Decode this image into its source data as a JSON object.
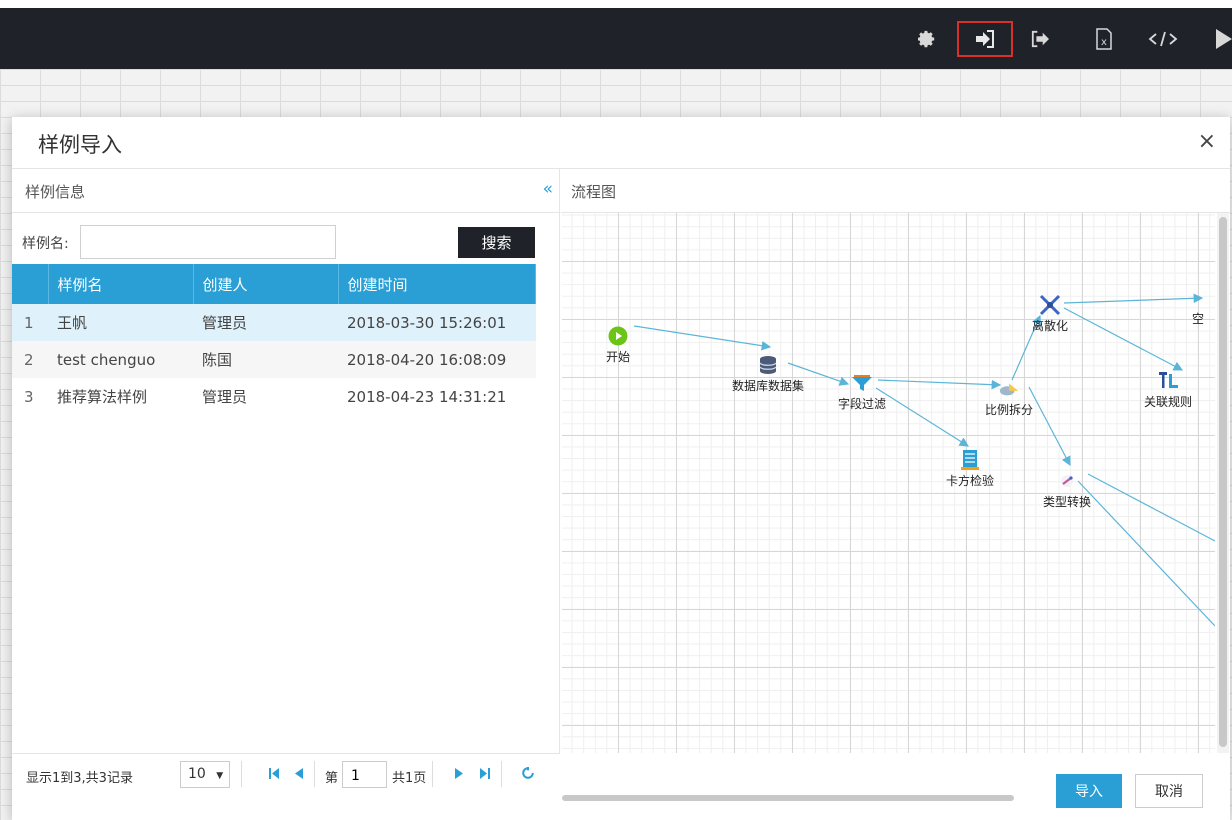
{
  "toolbar": {
    "icons": [
      "gear-icon",
      "import-icon",
      "export-icon",
      "excel-file-icon",
      "code-icon",
      "play-icon"
    ],
    "active_icon": "import-icon",
    "colors": {
      "bar": "#1f2329",
      "active_border": "#d9302a"
    }
  },
  "modal": {
    "title": "样例导入",
    "close_label": "×",
    "left_panel": {
      "title": "样例信息",
      "collapse_label": "«",
      "search": {
        "label": "样例名:",
        "value": "",
        "placeholder": "",
        "button_label": "搜索"
      },
      "table": {
        "headers": [
          "",
          "样例名",
          "创建人",
          "创建时间"
        ],
        "rows": [
          {
            "index": "1",
            "name": "王帆",
            "creator": "管理员",
            "created": "2018-03-30 15:26:01",
            "selected": true
          },
          {
            "index": "2",
            "name": "test chenguo",
            "creator": "陈国",
            "created": "2018-04-20 16:08:09",
            "selected": false
          },
          {
            "index": "3",
            "name": "推荐算法样例",
            "creator": "管理员",
            "created": "2018-04-23 14:31:21",
            "selected": false
          }
        ]
      },
      "pager": {
        "info": "显示1到3,共3记录",
        "page_size": "10",
        "page_prefix": "第",
        "page_number": "1",
        "total_pages": "共1页"
      }
    },
    "right_panel": {
      "title": "流程图",
      "nodes": [
        {
          "label": "开始",
          "icon": "play-circle-icon"
        },
        {
          "label": "数据库数据集",
          "icon": "database-icon"
        },
        {
          "label": "字段过滤",
          "icon": "filter-icon"
        },
        {
          "label": "卡方检验",
          "icon": "chi-square-icon"
        },
        {
          "label": "比例拆分",
          "icon": "split-icon"
        },
        {
          "label": "离散化",
          "icon": "discretize-icon"
        },
        {
          "label": "类型转换",
          "icon": "type-convert-icon"
        },
        {
          "label": "关联规则",
          "icon": "association-rule-icon"
        },
        {
          "label": "空",
          "icon": ""
        }
      ]
    },
    "buttons": {
      "import": "导入",
      "cancel": "取消"
    },
    "colors": {
      "accent": "#2a9fd6",
      "selected_row": "#dff1fa",
      "dark_button": "#1f2329"
    }
  }
}
